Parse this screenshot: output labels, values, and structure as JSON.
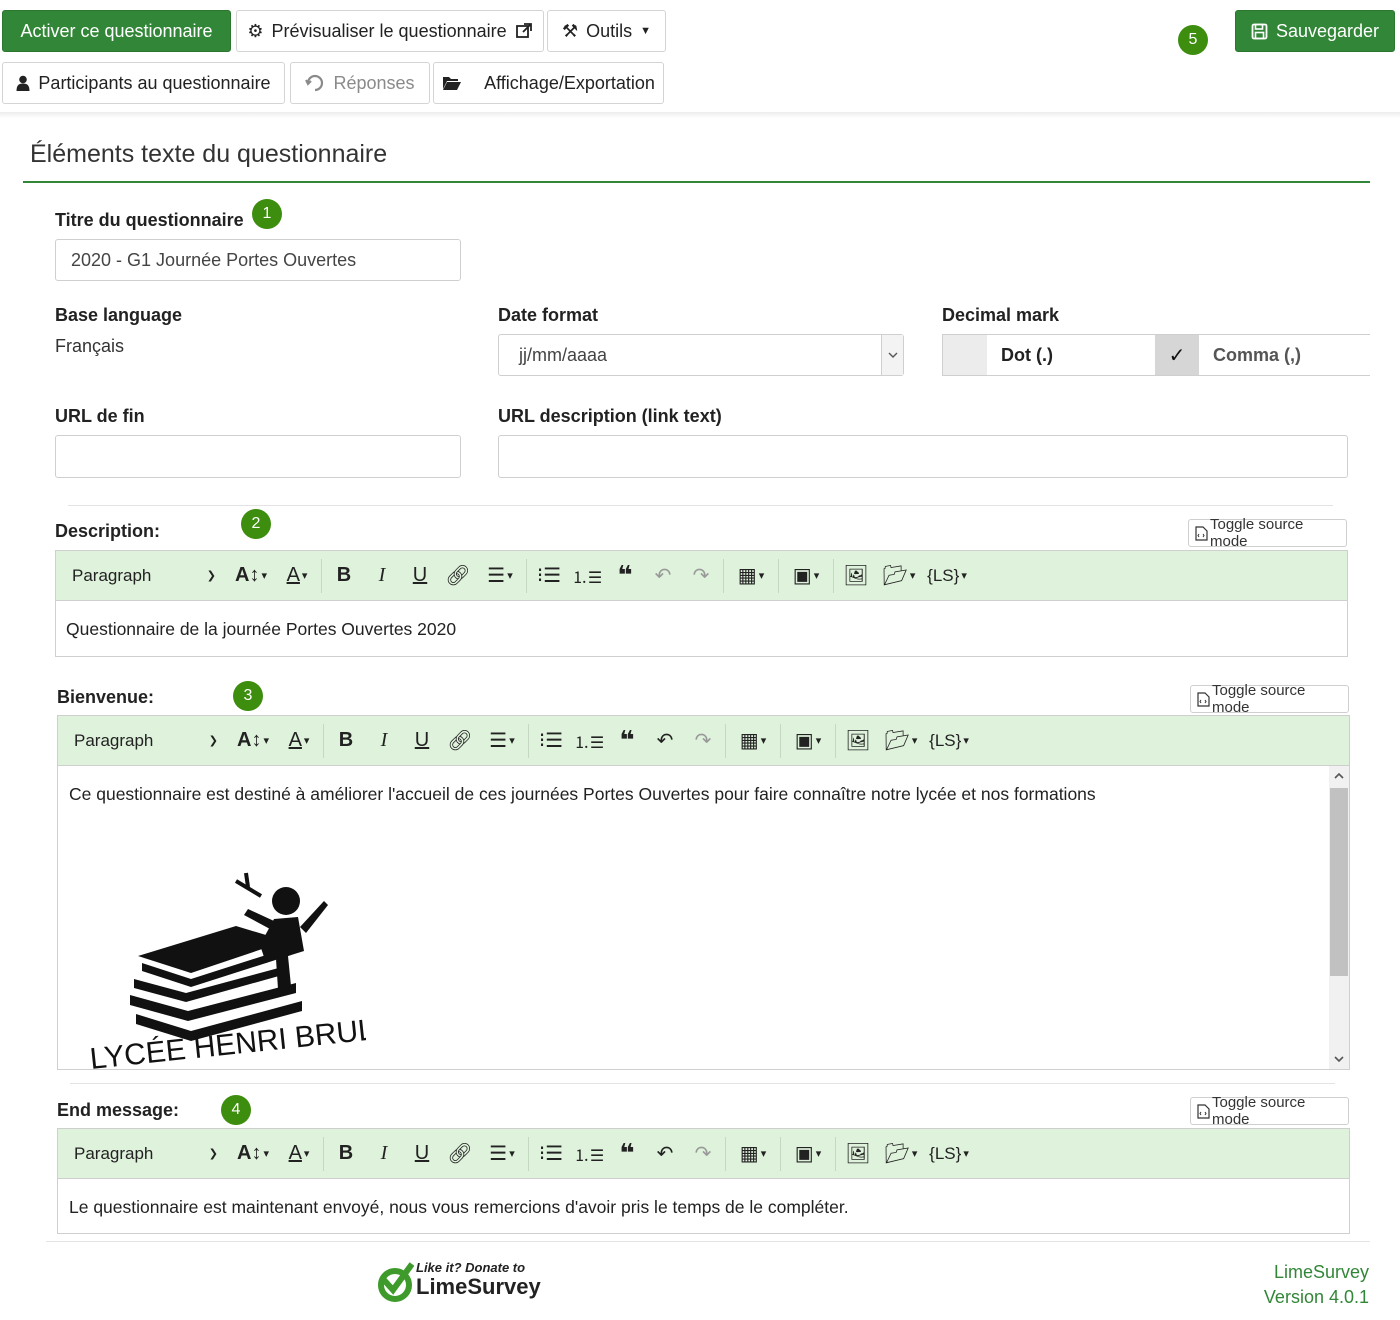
{
  "topbar": {
    "activate_label": "Activer ce questionnaire",
    "preview_label": "Prévisualiser le questionnaire",
    "tools_label": "Outils",
    "participants_label": "Participants au questionnaire",
    "responses_label": "Réponses",
    "display_export_label": "Affichage/Exportation",
    "save_label": "Sauvegarder",
    "badge_save": "5"
  },
  "section": {
    "title": "Éléments texte du questionnaire"
  },
  "form": {
    "title_label": "Titre du questionnaire",
    "title_badge": "1",
    "title_value": "2020 - G1 Journée Portes Ouvertes",
    "base_language_label": "Base language",
    "base_language_value": "Français",
    "date_format_label": "Date format",
    "date_format_value": "jj/mm/aaaa",
    "decimal_mark_label": "Decimal mark",
    "decimal_dot_label": "Dot (.)",
    "decimal_comma_label": "Comma (,)",
    "decimal_selected": "comma",
    "end_url_label": "URL de fin",
    "end_url_value": "",
    "url_desc_label": "URL description (link text)",
    "url_desc_value": ""
  },
  "editors": {
    "toggle_label": "Toggle source mode",
    "paragraph_label": "Paragraph",
    "description": {
      "label": "Description:",
      "badge": "2",
      "content": "Questionnaire de la journée Portes Ouvertes 2020"
    },
    "welcome": {
      "label": "Bienvenue:",
      "badge": "3",
      "content": "Ce questionnaire est destiné à améliorer l'accueil de ces journées Portes Ouvertes pour faire connaître notre lycée et nos formations",
      "logo_text": "LYCÉE HENRI BRULLE"
    },
    "end_message": {
      "label": "End message:",
      "badge": "4",
      "content": "Le questionnaire est maintenant envoyé, nous vous remercions d'avoir pris le temps de le compléter."
    }
  },
  "footer": {
    "donate_line1": "Like it? Donate to",
    "donate_line2": "LimeSurvey",
    "product_name": "LimeSurvey",
    "version": "Version 4.0.1"
  },
  "colors": {
    "brand_green": "#328637",
    "badge_green": "#3d8d0e",
    "toolbar_bg": "#dff3dc",
    "footer_text": "#328637"
  }
}
